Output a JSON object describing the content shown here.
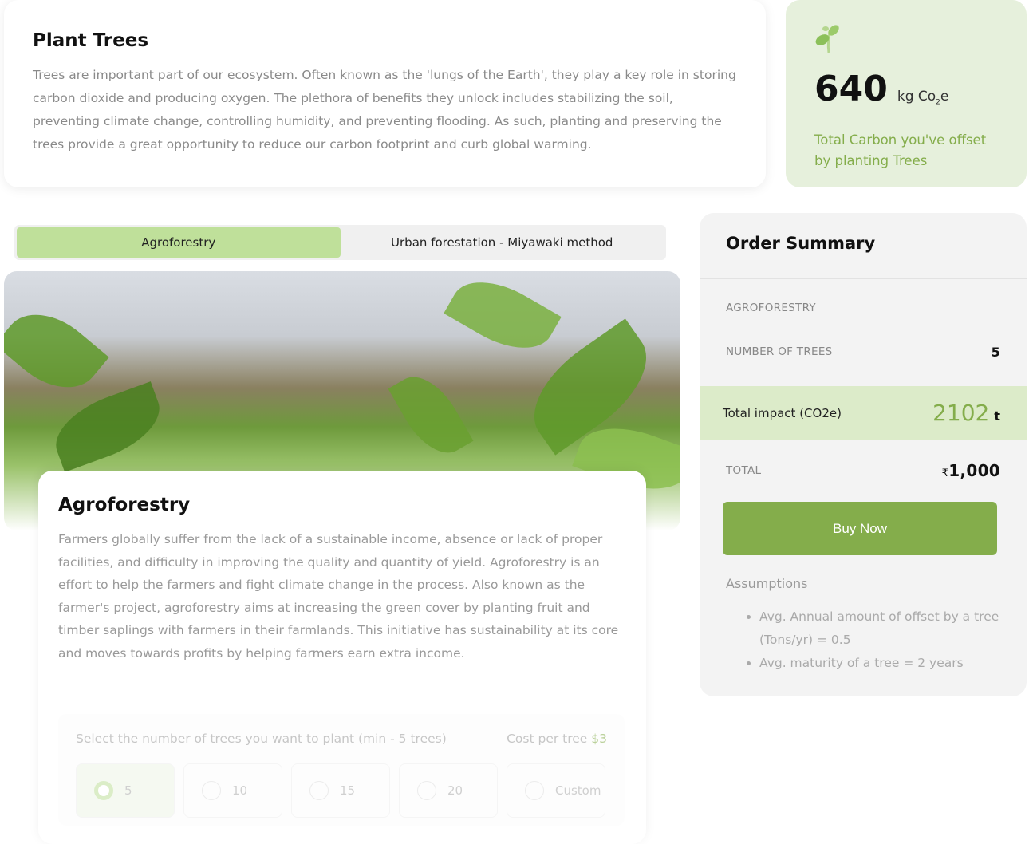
{
  "intro": {
    "title": "Plant Trees",
    "body": "Trees are important part of our ecosystem. Often known as the 'lungs of the Earth', they play a key role in storing carbon dioxide and producing oxygen. The plethora of benefits they unlock includes stabilizing the soil, preventing climate change, controlling humidity, and preventing flooding. As such, planting and preserving the trees provide a great opportunity to reduce our carbon footprint and curb global warming."
  },
  "carbon": {
    "icon": "sprout-icon",
    "value": "640",
    "unit_prefix": "kg Co",
    "unit_sub": "2",
    "unit_suffix": "e",
    "description": "Total Carbon you've offset by planting Trees"
  },
  "tabs": [
    {
      "label": "Agroforestry",
      "active": true
    },
    {
      "label": "Urban forestation - Miyawaki method",
      "active": false
    }
  ],
  "detail": {
    "title": "Agroforestry",
    "body": "Farmers globally suffer from the lack of a sustainable income, absence or lack of proper facilities, and difficulty in improving the quality and quantity of yield. Agroforestry is an effort to help the farmers and fight climate change in the process. Also known as the farmer's project, agroforestry aims at increasing the green cover by planting fruit and timber saplings with farmers in their farmlands. This initiative has sustainability at its core and moves towards profits by helping farmers earn extra income.",
    "select_label": "Select the number of trees you want to plant (min - 5 trees)",
    "cost_label": "Cost per tree ",
    "cost_value": "$3",
    "options": [
      {
        "label": "5",
        "selected": true
      },
      {
        "label": "10"
      },
      {
        "label": "15"
      },
      {
        "label": "20"
      },
      {
        "label": "Custom"
      }
    ]
  },
  "summary": {
    "title": "Order Summary",
    "project": "AGROFORESTRY",
    "trees_label": "NUMBER OF TREES",
    "trees_value": "5",
    "impact_label": "Total  impact (CO2e)",
    "impact_value": "2102",
    "impact_unit": "t",
    "total_label": "TOTAL",
    "total_currency": "₹",
    "total_value": "1,000",
    "buy_label": "Buy Now",
    "assumptions_title": "Assumptions",
    "assumptions": [
      "Avg. Annual amount of offset by a tree (Tons/yr) = 0.5",
      "Avg. maturity of a tree = 2 years"
    ]
  },
  "colors": {
    "accent": "#84ad4b",
    "light_green": "#e6f0dc",
    "tab_active": "#bfe09a"
  }
}
